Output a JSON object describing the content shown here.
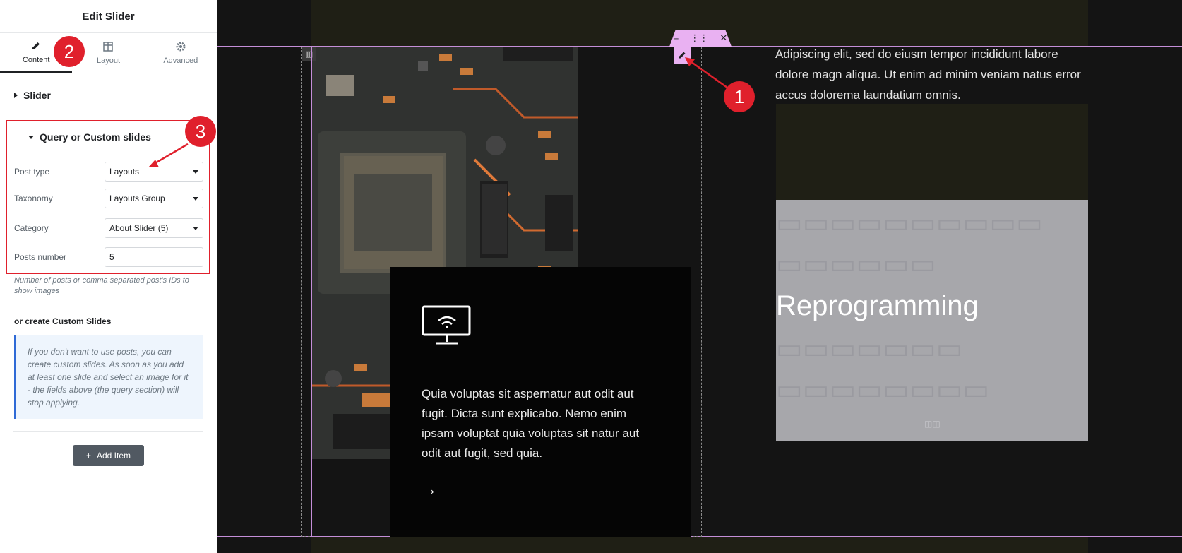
{
  "panel": {
    "title": "Edit Slider",
    "tabs": [
      {
        "label": "Content",
        "icon": "pencil-icon",
        "active": true
      },
      {
        "label": "Layout",
        "icon": "layout-icon",
        "active": false
      },
      {
        "label": "Advanced",
        "icon": "gear-icon",
        "active": false
      }
    ],
    "slider_section": "Slider",
    "query_section": {
      "title": "Query or Custom slides",
      "fields": [
        {
          "label": "Post type",
          "value": "Layouts"
        },
        {
          "label": "Taxonomy",
          "value": "Layouts Group"
        },
        {
          "label": "Category",
          "value": "About Slider (5)"
        },
        {
          "label": "Posts number",
          "value": "5"
        }
      ]
    },
    "help_text": "Number of posts or comma separated post's IDs to show images",
    "custom_heading": "or create Custom Slides",
    "notice": "If you don't want to use posts, you can create custom slides. As soon as you add at least one slide and select an image for it - the fields above (the query section) will stop applying.",
    "add_item": "Add Item"
  },
  "canvas": {
    "card_text": "Quia voluptas sit aspernatur aut odit aut fugit. Dicta sunt explicabo. Nemo enim ipsam voluptat quia voluptas sit natur aut odit aut fugit, sed quia.",
    "card_arrow": "→",
    "right_text": "Adipiscing elit, sed do eiusm tempor incididunt labore dolore magn aliqua. Ut enim ad minim veniam natus error accus dolorema laundatium omnis.",
    "active_word": "Reprogramming",
    "toolbar": {
      "add": "+",
      "move": "⋮⋮",
      "close": "✕"
    }
  },
  "annotations": [
    "1",
    "2",
    "3"
  ],
  "colors": {
    "annotation": "#e0202c",
    "accent": "#e9b1f2"
  }
}
